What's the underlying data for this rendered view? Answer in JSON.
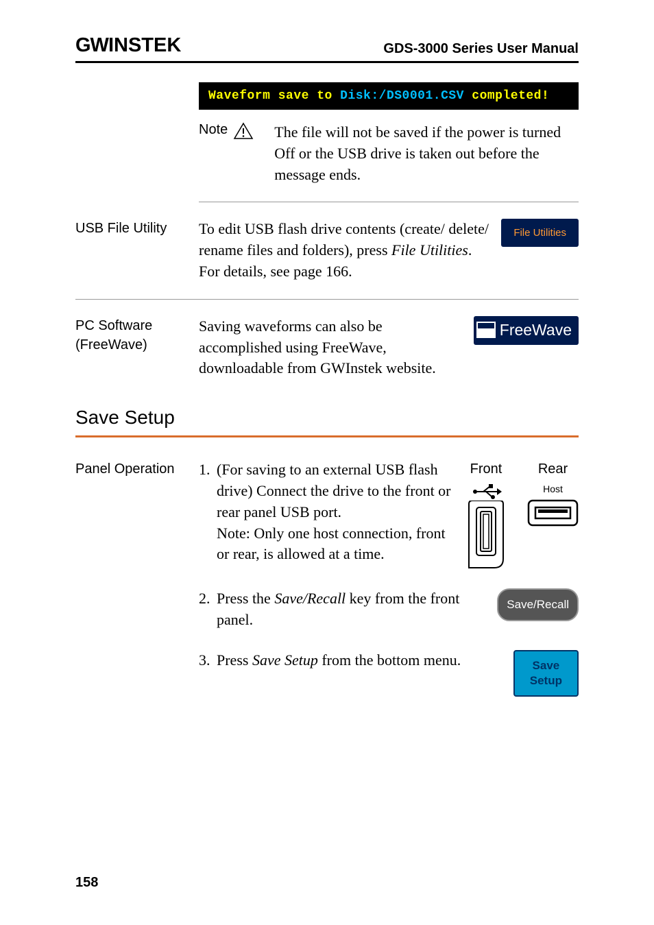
{
  "header": {
    "logo": "GWINSTEK",
    "title": "GDS-3000 Series User Manual"
  },
  "waveform_banner": {
    "prefix": "Waveform save to ",
    "disk": "Disk:/DS0001.CSV",
    "suffix": " completed!"
  },
  "note": {
    "label": "Note",
    "text": "The file will not be saved if the power is turned Off or the USB drive is taken out before the message ends."
  },
  "usb_file_utility": {
    "label": "USB File Utility",
    "text_1": "To edit USB flash drive contents (create/ delete/ rename files and folders), press ",
    "italic": "File Utilities",
    "text_2": ". For details, see page 166.",
    "button": "File Utilities"
  },
  "pc_software": {
    "label_1": "PC Software",
    "label_2": "(FreeWave)",
    "text": "Saving waveforms can also be accomplished using FreeWave, downloadable from GWInstek website.",
    "badge": "FreeWave"
  },
  "save_setup_heading": "Save Setup",
  "panel_operation": {
    "label": "Panel Operation",
    "step1": {
      "num": "1.",
      "text": "(For saving to an external USB flash drive) Connect the drive to the front or rear panel USB port.",
      "note": "Note: Only one host connection, front or rear, is allowed at a time.",
      "front_label": "Front",
      "rear_label": "Rear",
      "host_label": "Host"
    },
    "step2": {
      "num": "2.",
      "text_1": "Press the ",
      "italic": "Save/Recall",
      "text_2": " key from the front panel.",
      "button": "Save/Recall"
    },
    "step3": {
      "num": "3.",
      "text_1": "Press ",
      "italic": "Save Setup",
      "text_2": " from the bottom menu.",
      "button_1": "Save",
      "button_2": "Setup"
    }
  },
  "page_number": "158"
}
